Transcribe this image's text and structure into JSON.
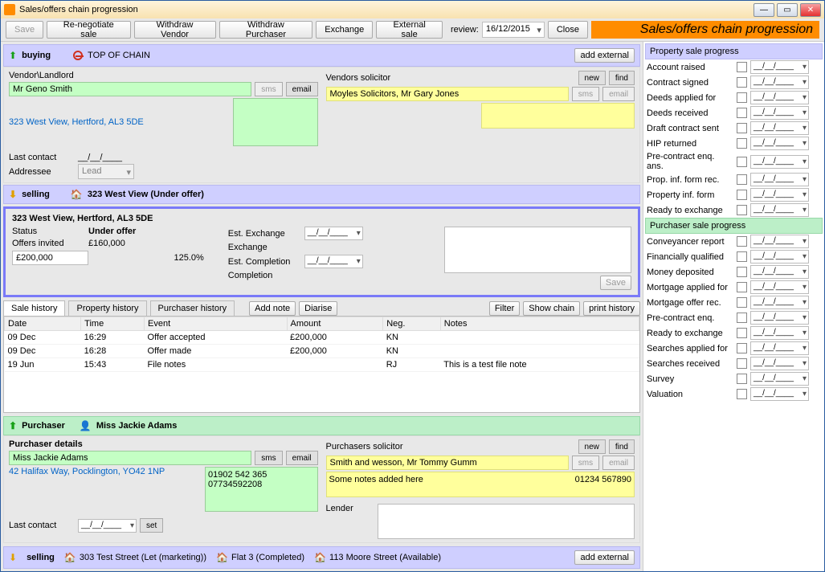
{
  "window_title": "Sales/offers chain progression",
  "toolbar": {
    "save": "Save",
    "renegotiate": "Re-negotiate sale",
    "withdraw_vendor": "Withdraw Vendor",
    "withdraw_purchaser": "Withdraw Purchaser",
    "exchange": "Exchange",
    "external_sale": "External sale",
    "review_label": "review:",
    "review_date": "16/12/2015",
    "close": "Close",
    "title_strip": "Sales/offers chain progression"
  },
  "buying": {
    "label": "buying",
    "top": "TOP OF CHAIN",
    "add_external": "add external",
    "vendor_label": "Vendor\\Landlord",
    "vendor_name": "Mr Geno Smith",
    "vendor_addr": "323 West View, Hertford, AL3 5DE",
    "sms": "sms",
    "email": "email",
    "last_contact_label": "Last contact",
    "last_contact": "__/__/____",
    "addressee_label": "Addressee",
    "addressee": "Lead",
    "sol_label": "Vendors solicitor",
    "sol_name": "Moyles Solicitors, Mr Gary Jones",
    "new": "new",
    "find": "find"
  },
  "selling_hdr": {
    "label": "selling",
    "text": "323 West View (Under offer)"
  },
  "card": {
    "title": "323 West View, Hertford, AL3 5DE",
    "status_lbl": "Status",
    "status": "Under offer",
    "offers_invited_lbl": "Offers invited",
    "offers_invited": "£160,000",
    "price": "£200,000",
    "percent": "125.0%",
    "est_exch_lbl": "Est. Exchange",
    "exchange_lbl": "Exchange",
    "est_comp_lbl": "Est. Completion",
    "completion_lbl": "Completion",
    "date_blank": "__/__/____",
    "save": "Save"
  },
  "tabs": {
    "sale_history": "Sale history",
    "property_history": "Property history",
    "purchaser_history": "Purchaser history",
    "add_note": "Add note",
    "diarise": "Diarise",
    "filter": "Filter",
    "show_chain": "Show chain",
    "print_history": "print history"
  },
  "grid": {
    "headers": [
      "Date",
      "Time",
      "Event",
      "Amount",
      "Neg.",
      "Notes"
    ],
    "rows": [
      [
        "09 Dec",
        "16:29",
        "Offer accepted",
        "£200,000",
        "KN",
        ""
      ],
      [
        "09 Dec",
        "16:28",
        "Offer made",
        "£200,000",
        "KN",
        ""
      ],
      [
        "19 Jun",
        "15:43",
        "File notes",
        "",
        "RJ",
        "This is a test file note"
      ]
    ]
  },
  "purchaser": {
    "header": "Purchaser",
    "name_hdr": "Miss Jackie Adams",
    "details_label": "Purchaser details",
    "name": "Miss Jackie Adams",
    "addr": "42 Halifax Way, Pocklington, YO42 1NP",
    "phone1": "01902 542 365",
    "phone2": "07734592208",
    "last_contact_lbl": "Last contact",
    "last_contact": "__/__/____",
    "set": "set",
    "sol_label": "Purchasers solicitor",
    "sol_name": "Smith and wesson, Mr Tommy Gumm",
    "sol_notes": "Some notes added here",
    "sol_phone": "01234 567890",
    "lender_lbl": "Lender",
    "new": "new",
    "find": "find",
    "sms": "sms",
    "email": "email"
  },
  "bottom": {
    "label": "selling",
    "p1": "303 Test Street (Let (marketing))",
    "p2": "Flat 3 (Completed)",
    "p3": "113 Moore Street (Available)",
    "add_external": "add external"
  },
  "progress_sale_hdr": "Property sale progress",
  "progress_sale": [
    "Account raised",
    "Contract signed",
    "Deeds applied for",
    "Deeds received",
    "Draft contract sent",
    "HIP returned",
    "Pre-contract enq. ans.",
    "Prop. inf. form rec.",
    "Property inf. form",
    "Ready to exchange"
  ],
  "progress_purch_hdr": "Purchaser sale progress",
  "progress_purch": [
    "Conveyancer report",
    "Financially qualified",
    "Money deposited",
    "Mortgage applied for",
    "Mortgage offer rec.",
    "Pre-contract enq.",
    "Ready to exchange",
    "Searches applied for",
    "Searches received",
    "Survey",
    "Valuation"
  ],
  "date_blank": "__/__/____"
}
